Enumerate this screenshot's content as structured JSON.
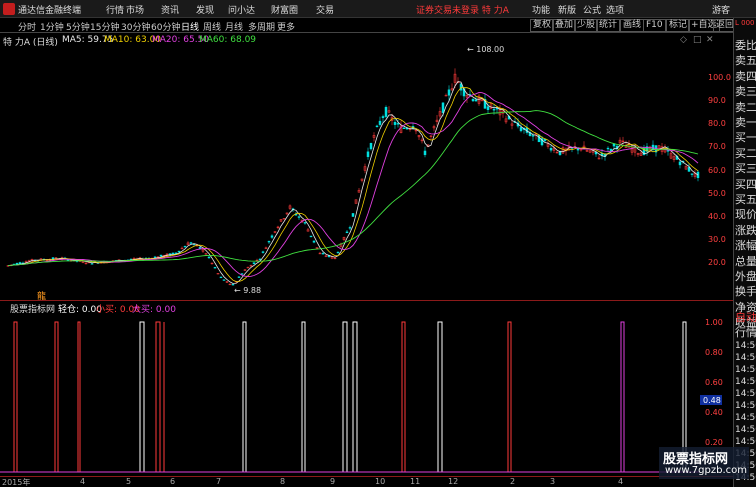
{
  "titlebar": {
    "app_title": "通达信金融终端",
    "menus": [
      "行情",
      "市场",
      "资讯",
      "发现",
      "问小达",
      "财富圈",
      "交易"
    ],
    "status": "证券交易未登录  特 力A",
    "right_menus": [
      "功能",
      "新版",
      "公式",
      "选项"
    ],
    "user": "游客"
  },
  "periodbar": {
    "periods": [
      "分时",
      "1分钟",
      "5分钟",
      "15分钟",
      "30分钟",
      "60分钟",
      "日线",
      "周线",
      "月线",
      "多周期",
      "更多"
    ],
    "active": "日线",
    "tools": [
      "复权",
      "叠加",
      "少股",
      "统计",
      "画线",
      "F10",
      "标记",
      "+自选",
      "返回"
    ]
  },
  "ma_legend": {
    "stock": "特 力A (日线)",
    "items": [
      {
        "label": "MA5: 59.75",
        "color": "#e8e8e8"
      },
      {
        "label": "MA10: 63.00",
        "color": "#f0d000"
      },
      {
        "label": "MA20: 65.50",
        "color": "#e040e0"
      },
      {
        "label": "MA60: 68.09",
        "color": "#40e040"
      }
    ]
  },
  "annotations": {
    "high": "108.00",
    "low": "9.88",
    "mark": "龍"
  },
  "y_axis_main": [
    "100.0",
    "90.0",
    "80.0",
    "70.0",
    "60.0",
    "50.0",
    "40.0",
    "30.0",
    "20.0"
  ],
  "y_axis_sub": [
    "1.00",
    "0.80",
    "0.60",
    "0.40",
    "0.20"
  ],
  "sub_value": "0.48",
  "sub_legend": {
    "name": "股票指标网",
    "items": [
      {
        "label": "轻仓: 0.00",
        "color": "#ffffff"
      },
      {
        "label": "小买: 0.00",
        "color": "#ff3a3a"
      },
      {
        "label": "大买: 0.00",
        "color": "#e040e0"
      }
    ]
  },
  "x_axis": [
    "2015年",
    "4",
    "5",
    "6",
    "7",
    "8",
    "9",
    "10",
    "11",
    "12",
    "2",
    "3",
    "4"
  ],
  "right_panel": {
    "code": "L 000",
    "labels": [
      "委比",
      "卖五",
      "卖四",
      "卖三",
      "卖二",
      "卖一",
      "买一",
      "买二",
      "买三",
      "买四",
      "买五",
      "现价",
      "涨跌",
      "涨幅",
      "总量",
      "外盘",
      "换手",
      "净资",
      "收益"
    ],
    "tick_title": "自动",
    "tick_title2": "行情",
    "ticks": [
      "14:50",
      "14:50",
      "14:50",
      "14:50",
      "14:50",
      "14:50",
      "14:50",
      "14:50",
      "14:50",
      "14:50",
      "14:50",
      "14:50"
    ]
  },
  "watermark": {
    "line1": "股票指标网",
    "line2": "www.7gpzb.com"
  },
  "colors": {
    "up": "#ff3a3a",
    "down": "#00e0e0",
    "ma5": "#e8e8e8",
    "ma10": "#f0d000",
    "ma20": "#e040e0",
    "ma60": "#40e040"
  }
}
